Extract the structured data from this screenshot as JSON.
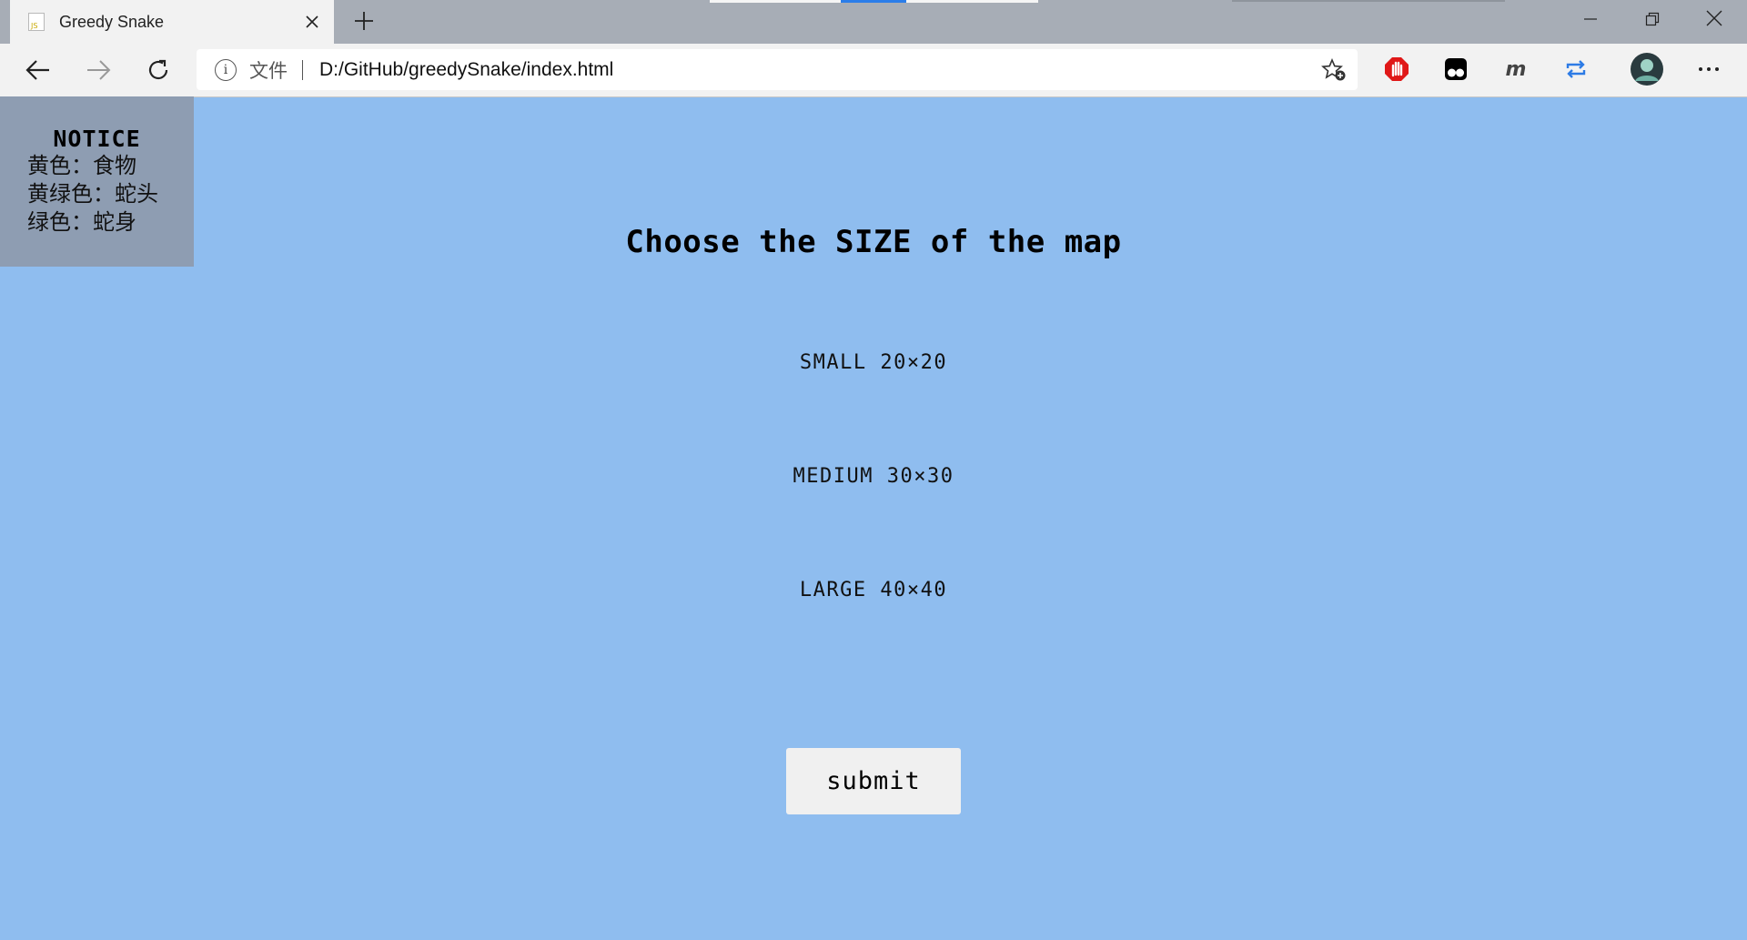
{
  "browser": {
    "tab": {
      "title": "Greedy Snake",
      "favicon_text": "JS"
    },
    "new_tab_icon": "plus-icon",
    "window_controls": [
      "minimize-icon",
      "restore-icon",
      "close-icon"
    ],
    "address": {
      "scheme_label": "文件",
      "url": "D:/GitHub/greedySnake/index.html"
    },
    "colors": {
      "titlebar": "#a7adb6",
      "toolbar": "#f2f2f2",
      "page_bg": "#8fbdef"
    }
  },
  "notice": {
    "title": "NOTICE",
    "lines": [
      "黄色：食物",
      "黄绿色：蛇头",
      "绿色：蛇身"
    ]
  },
  "main": {
    "heading": "Choose the SIZE of the map",
    "options": [
      {
        "label": "SMALL 20×20"
      },
      {
        "label": "MEDIUM 30×30"
      },
      {
        "label": "LARGE 40×40"
      }
    ],
    "submit_label": "submit"
  }
}
